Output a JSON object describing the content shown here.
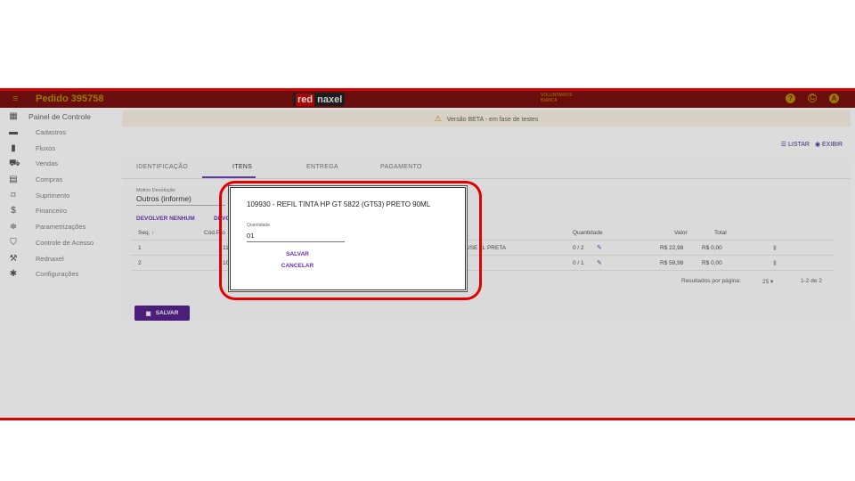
{
  "header": {
    "menu_icon": "menu-icon",
    "order_title": "Pedido 395758",
    "logo_red": "red",
    "logo_rest": "naxel",
    "user_line1": "VOLUNTARIOS",
    "user_line2": "BIANCA",
    "help_icon": "?",
    "refresh_icon": "C",
    "account_icon": "A"
  },
  "sidebar": {
    "items": [
      {
        "label": "Painel de Controle",
        "icon": "dashboard-icon"
      },
      {
        "label": "Cadastros",
        "icon": "folder-icon"
      },
      {
        "label": "Fluxos",
        "icon": "columns-icon"
      },
      {
        "label": "Vendas",
        "icon": "cart-icon"
      },
      {
        "label": "Compras",
        "icon": "compras-icon"
      },
      {
        "label": "Suprimento",
        "icon": "box-icon"
      },
      {
        "label": "Financeiro",
        "icon": "money-icon"
      },
      {
        "label": "Parametrizações",
        "icon": "sliders-icon"
      },
      {
        "label": "Controle de Acesso",
        "icon": "shield-icon"
      },
      {
        "label": "Rednaxel",
        "icon": "wrench-icon"
      },
      {
        "label": "Configurações",
        "icon": "gear-icon"
      }
    ]
  },
  "banner": {
    "text": "Versão BETA - em fase de testes"
  },
  "actions": {
    "list": "LISTAR",
    "show": "EXIBIR"
  },
  "tabs": [
    "IDENTIFICAÇÃO",
    "ITENS",
    "ENTREGA",
    "PAGAMENTO"
  ],
  "form": {
    "motivo_label": "Motivo Devolução",
    "motivo_value": "Outros (informe)"
  },
  "buttons": {
    "devolver_nenhum": "DEVOLVER NENHUM",
    "devolver_todos": "DEVOL",
    "save_main": "SALVAR"
  },
  "table": {
    "headers": {
      "seq": "Seq. ↑",
      "cod": "Cód.Pro",
      "quantidade": "Quantidade",
      "valor": "Valor",
      "total": "Total"
    },
    "rows": [
      {
        "seq": "1",
        "cod": "11",
        "desc": "USE 1L PRETA",
        "qty": "0 / 2",
        "valor": "R$ 22,98",
        "total": "R$ 0,00"
      },
      {
        "seq": "2",
        "cod": "1C",
        "desc": "",
        "qty": "0 / 1",
        "valor": "R$ 59,98",
        "total": "R$ 0,00"
      }
    ]
  },
  "pager": {
    "label": "Resultados por página:",
    "per_page": "25 ▾",
    "range": "1-2 de 2"
  },
  "dialog": {
    "title": "109930 - REFIL TINTA HP GT 5822 (GT53) PRETO 90ML",
    "qty_label": "Quantidade",
    "qty_value": "01",
    "save": "SALVAR",
    "cancel": "CANCELAR"
  }
}
